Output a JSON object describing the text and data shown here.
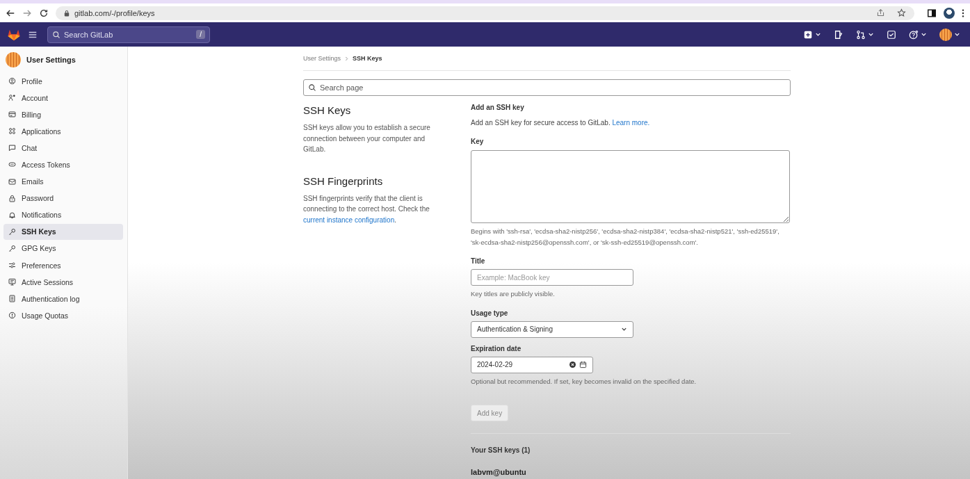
{
  "browser": {
    "url": "gitlab.com/-/profile/keys"
  },
  "navbar": {
    "search": {
      "placeholder": "Search GitLab",
      "shortcut": "/"
    }
  },
  "sidebar": {
    "title": "User Settings",
    "items": [
      {
        "label": "Profile",
        "selected": false
      },
      {
        "label": "Account",
        "selected": false
      },
      {
        "label": "Billing",
        "selected": false
      },
      {
        "label": "Applications",
        "selected": false
      },
      {
        "label": "Chat",
        "selected": false
      },
      {
        "label": "Access Tokens",
        "selected": false
      },
      {
        "label": "Emails",
        "selected": false
      },
      {
        "label": "Password",
        "selected": false
      },
      {
        "label": "Notifications",
        "selected": false
      },
      {
        "label": "SSH Keys",
        "selected": true
      },
      {
        "label": "GPG Keys",
        "selected": false
      },
      {
        "label": "Preferences",
        "selected": false
      },
      {
        "label": "Active Sessions",
        "selected": false
      },
      {
        "label": "Authentication log",
        "selected": false
      },
      {
        "label": "Usage Quotas",
        "selected": false
      }
    ]
  },
  "breadcrumb": [
    "User Settings",
    "SSH Keys"
  ],
  "search_page": {
    "placeholder": "Search page"
  },
  "intro": [
    {
      "heading": "SSH Keys",
      "text": "SSH keys allow you to establish a secure connection between your computer and GitLab."
    },
    {
      "heading": "SSH Fingerprints",
      "text": "SSH fingerprints verify that the client is connecting to the correct host. Check the ",
      "link": "current instance configuration",
      "after": "."
    }
  ],
  "form": {
    "heading": "Add an SSH key",
    "description": "Add an SSH key for secure access to GitLab. ",
    "learn_more": "Learn more.",
    "key_label": "Key",
    "key_help": "Begins with 'ssh-rsa', 'ecdsa-sha2-nistp256', 'ecdsa-sha2-nistp384', 'ecdsa-sha2-nistp521', 'ssh-ed25519', 'sk-ecdsa-sha2-nistp256@openssh.com', or 'sk-ssh-ed25519@openssh.com'.",
    "title_label": "Title",
    "title_placeholder": "Example: MacBook key",
    "title_help": "Key titles are publicly visible.",
    "usage_label": "Usage type",
    "usage_value": "Authentication & Signing",
    "expiration_label": "Expiration date",
    "expiration_value": "2024-02-29",
    "expiration_help": "Optional but recommended. If set, key becomes invalid on the specified date.",
    "submit": {
      "label": "Add key",
      "disabled": true
    }
  },
  "keys": {
    "heading": "Your SSH keys (1)",
    "items": [
      {
        "title": "labvm@ubuntu"
      }
    ]
  }
}
